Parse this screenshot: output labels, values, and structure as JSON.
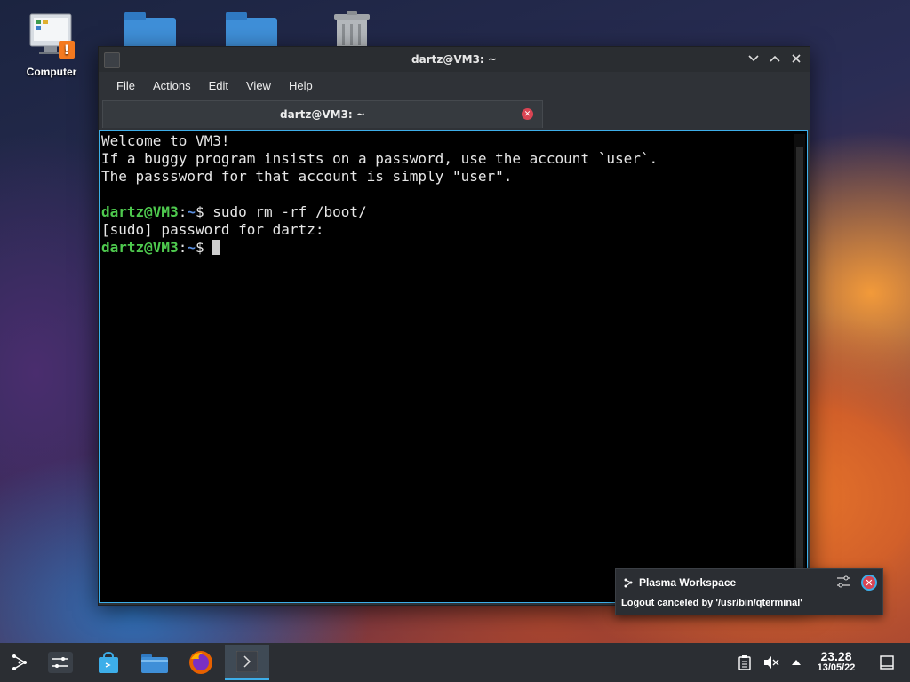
{
  "desktop": {
    "icons": [
      {
        "label": "Computer"
      },
      {
        "label": ""
      },
      {
        "label": ""
      },
      {
        "label": ""
      }
    ]
  },
  "window": {
    "title": "dartz@VM3: ~",
    "menu": [
      "File",
      "Actions",
      "Edit",
      "View",
      "Help"
    ],
    "tab_title": "dartz@VM3: ~"
  },
  "terminal": {
    "lines": [
      "Welcome to VM3!",
      "If a buggy program insists on a password, use the account `user`.",
      "The passsword for that account is simply \"user\".",
      ""
    ],
    "prompt_user": "dartz@VM3",
    "prompt_path": "~",
    "prompt_symbol": "$",
    "command": " sudo rm -rf /boot/",
    "sudo_line": "[sudo] password for dartz:"
  },
  "notification": {
    "app": "Plasma Workspace",
    "message": "Logout canceled by '/usr/bin/qterminal'"
  },
  "taskbar": {
    "time": "23.28",
    "date": "13/05/22"
  },
  "colors": {
    "accent": "#3daee9",
    "prompt_green": "#4ec94e",
    "prompt_blue": "#5a8fe0",
    "close_red": "#da4453"
  }
}
